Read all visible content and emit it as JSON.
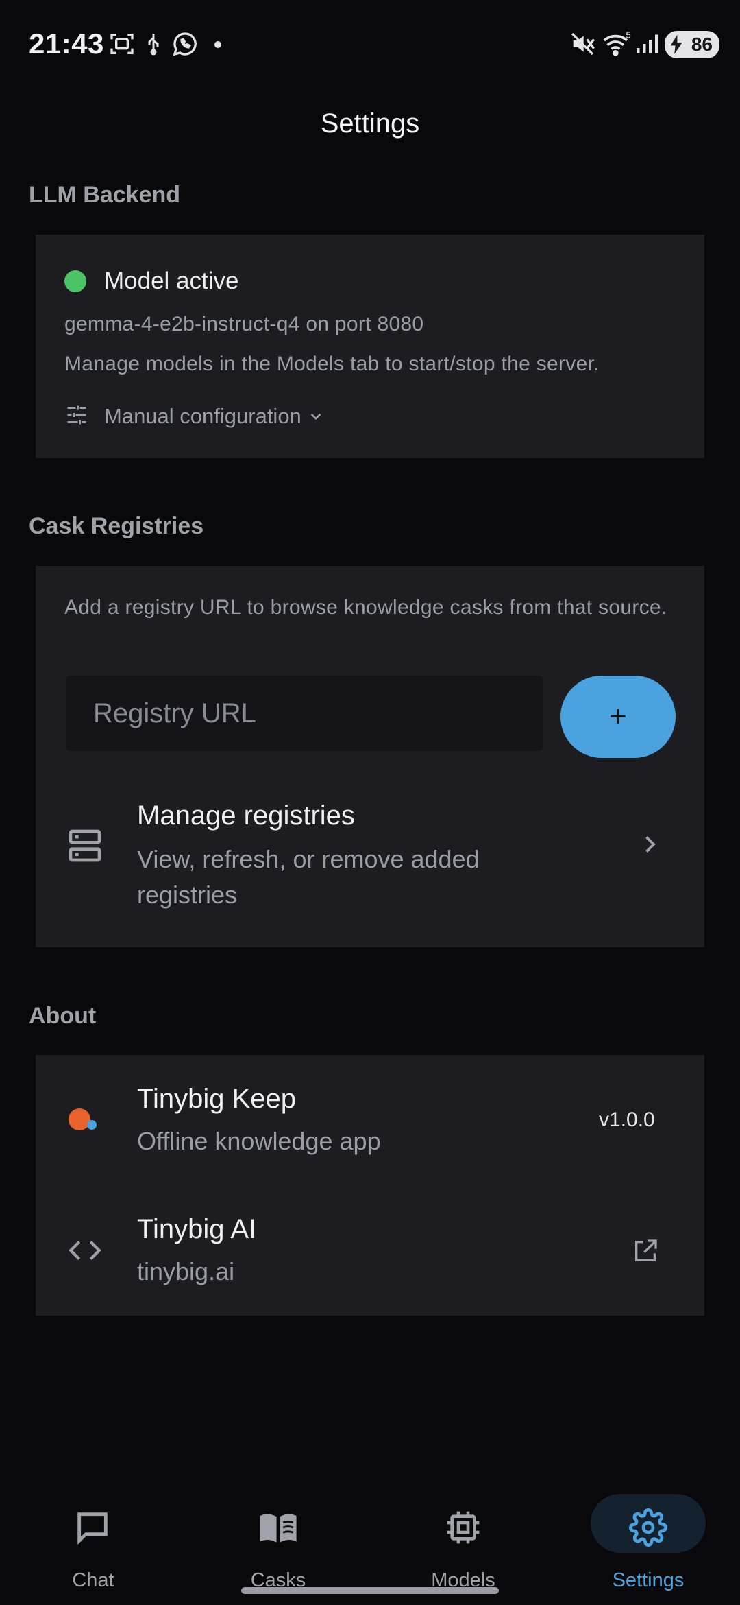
{
  "status_bar": {
    "time": "21:43",
    "battery": "86",
    "icons": [
      "screenshot-icon",
      "usb-icon",
      "whatsapp-icon",
      "notification-dot",
      "mute-icon",
      "wifi-icon",
      "signal-icon",
      "battery-charging-icon"
    ]
  },
  "header": {
    "title": "Settings"
  },
  "llm_backend": {
    "section_title": "LLM Backend",
    "status": "Model active",
    "status_color": "#4cc466",
    "model_line": "gemma-4-e2b-instruct-q4 on port 8080",
    "hint": "Manage models in the Models tab to start/stop the server.",
    "manual_config_label": "Manual configuration"
  },
  "cask_registries": {
    "section_title": "Cask Registries",
    "description": "Add a registry URL to browse knowledge casks from that source.",
    "input_placeholder": "Registry URL",
    "input_value": "",
    "add_button_label": "+",
    "manage": {
      "title": "Manage registries",
      "subtitle": "View, refresh, or remove added registries"
    }
  },
  "about": {
    "section_title": "About",
    "app": {
      "title": "Tinybig Keep",
      "subtitle": "Offline knowledge app",
      "version": "v1.0.0"
    },
    "company": {
      "title": "Tinybig AI",
      "subtitle": "tinybig.ai"
    }
  },
  "nav": {
    "items": [
      {
        "label": "Chat",
        "icon": "chat-icon"
      },
      {
        "label": "Casks",
        "icon": "book-icon"
      },
      {
        "label": "Models",
        "icon": "chip-icon"
      },
      {
        "label": "Settings",
        "icon": "gear-icon"
      }
    ],
    "active_index": 3
  },
  "colors": {
    "accent": "#4aa3de",
    "background": "#09090b",
    "card": "#1c1c21"
  }
}
